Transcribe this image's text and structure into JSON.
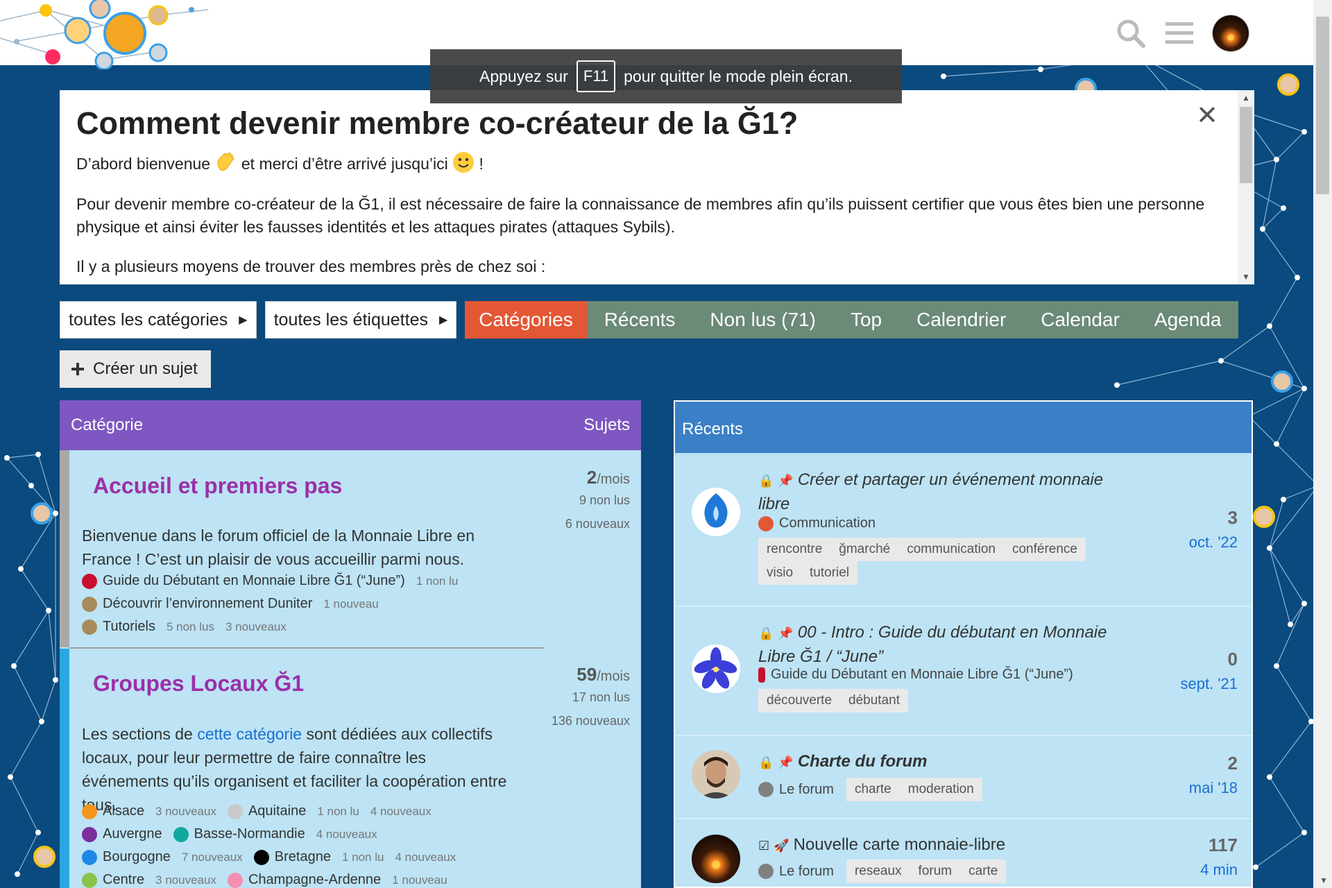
{
  "toast": {
    "before": "Appuyez sur",
    "key": "F11",
    "after": "pour quitter le mode plein écran."
  },
  "banner": {
    "title": "Comment devenir membre co-créateur de la Ğ1?",
    "p1_a": "D’abord bienvenue",
    "p1_b": "et merci d’être arrivé jusqu’ici",
    "p1_c": "!",
    "p2": "Pour devenir membre co-créateur de la Ğ1, il est nécessaire de faire la connaissance de membres afin qu’ils puissent certifier que vous êtes bien une personne physique et ainsi éviter les fausses identités et les attaques pirates (attaques Sybils).",
    "p3": "Il y a plusieurs moyens de trouver des membres près de chez soi :",
    "close": "✕"
  },
  "nav": {
    "categories_dropdown": "toutes les catégories",
    "tags_dropdown": "toutes les étiquettes",
    "tabs": [
      "Catégories",
      "Récents",
      "Non lus (71)",
      "Top",
      "Calendrier",
      "Calendar",
      "Agenda"
    ],
    "create": "Créer un sujet"
  },
  "categories": {
    "header_left": "Catégorie",
    "header_right": "Sujets",
    "items": [
      {
        "name": "Accueil et premiers pas",
        "desc": "Bienvenue dans le forum officiel de la Monnaie Libre en France ! C’est un plaisir de vous accueillir parmi nous.",
        "stat_big": "2",
        "stat_unit": "/mois",
        "unread": "9 non lus",
        "new": "6 nouveaux",
        "subs": [
          {
            "name": "Guide du Débutant en Monnaie Libre Ğ1 (“June”)",
            "count": "1 non lu",
            "color": "#c8102e"
          },
          {
            "name": "Découvrir l’environnement Duniter",
            "count": "1 nouveau",
            "color": "#a98a5a"
          },
          {
            "name": "Tutoriels",
            "count": "5 non lus",
            "count2": "3 nouveaux",
            "color": "#a98a5a"
          }
        ]
      },
      {
        "name": "Groupes Locaux Ğ1",
        "desc_a": "Les sections de",
        "desc_link": "cette catégorie",
        "desc_b": "sont dédiées aux collectifs locaux, pour leur permettre de faire connaître les événements qu’ils organisent et faciliter la coopération entre tous.",
        "stat_big": "59",
        "stat_unit": "/mois",
        "unread": "17 non lus",
        "new": "136 nouveaux",
        "subs": [
          {
            "name": "Alsace",
            "count": "3 nouveaux",
            "color": "#f7941d"
          },
          {
            "name": "Aquitaine",
            "count": "1 non lu",
            "count2": "4 nouveaux",
            "color": "#c9c9c9"
          },
          {
            "name": "Auvergne",
            "color": "#7b2f9c"
          },
          {
            "name": "Basse-Normandie",
            "count": "4 nouveaux",
            "color": "#12a89d"
          },
          {
            "name": "Bourgogne",
            "count": "7 nouveaux",
            "color": "#1e88e5"
          },
          {
            "name": "Bretagne",
            "count": "1 non lu",
            "count2": "4 nouveaux",
            "color": "#000000"
          },
          {
            "name": "Centre",
            "count": "3 nouveaux",
            "color": "#8bc34a"
          },
          {
            "name": "Champagne-Ardenne",
            "count": "1 nouveau",
            "color": "#f48fb1"
          }
        ]
      }
    ]
  },
  "recent": {
    "header": "Récents",
    "topics": [
      {
        "title": "Créer et partager un événement monnaie libre",
        "category": "Communication",
        "cat_color": "#e45735",
        "tags": [
          "rencontre",
          "ğmarché",
          "communication",
          "conférence",
          "visio",
          "tutoriel"
        ],
        "count": "3",
        "date": "oct. '22"
      },
      {
        "title": "00 - Intro : Guide du débutant en Monnaie Libre Ğ1 / “June”",
        "category": "Guide du Débutant en Monnaie Libre Ğ1 (“June”)",
        "cat_color": "#c8102e",
        "tags": [
          "découverte",
          "débutant"
        ],
        "count": "0",
        "date": "sept. '21"
      },
      {
        "title": "Charte du forum",
        "category": "Le forum",
        "cat_color": "#808080",
        "tags": [
          "charte",
          "moderation"
        ],
        "count": "2",
        "date": "mai '18"
      },
      {
        "title": "Nouvelle carte monnaie-libre",
        "category": "Le forum",
        "cat_color": "#808080",
        "tags": [
          "reseaux",
          "forum",
          "carte"
        ],
        "count": "117",
        "date": "4 min"
      }
    ]
  },
  "colors": {
    "accent": "#e45735",
    "nav_bg": "#6b8a77",
    "cat_header": "#7f57c2",
    "recent_header": "#3b80c6",
    "panel_bg": "#bde3f5",
    "page_bg": "#0a4a7e"
  },
  "icons": [
    "search-icon",
    "hamburger-menu-icon",
    "user-avatar",
    "close-icon",
    "lock-icon",
    "pin-icon",
    "plus-icon",
    "caret-right-icon"
  ]
}
